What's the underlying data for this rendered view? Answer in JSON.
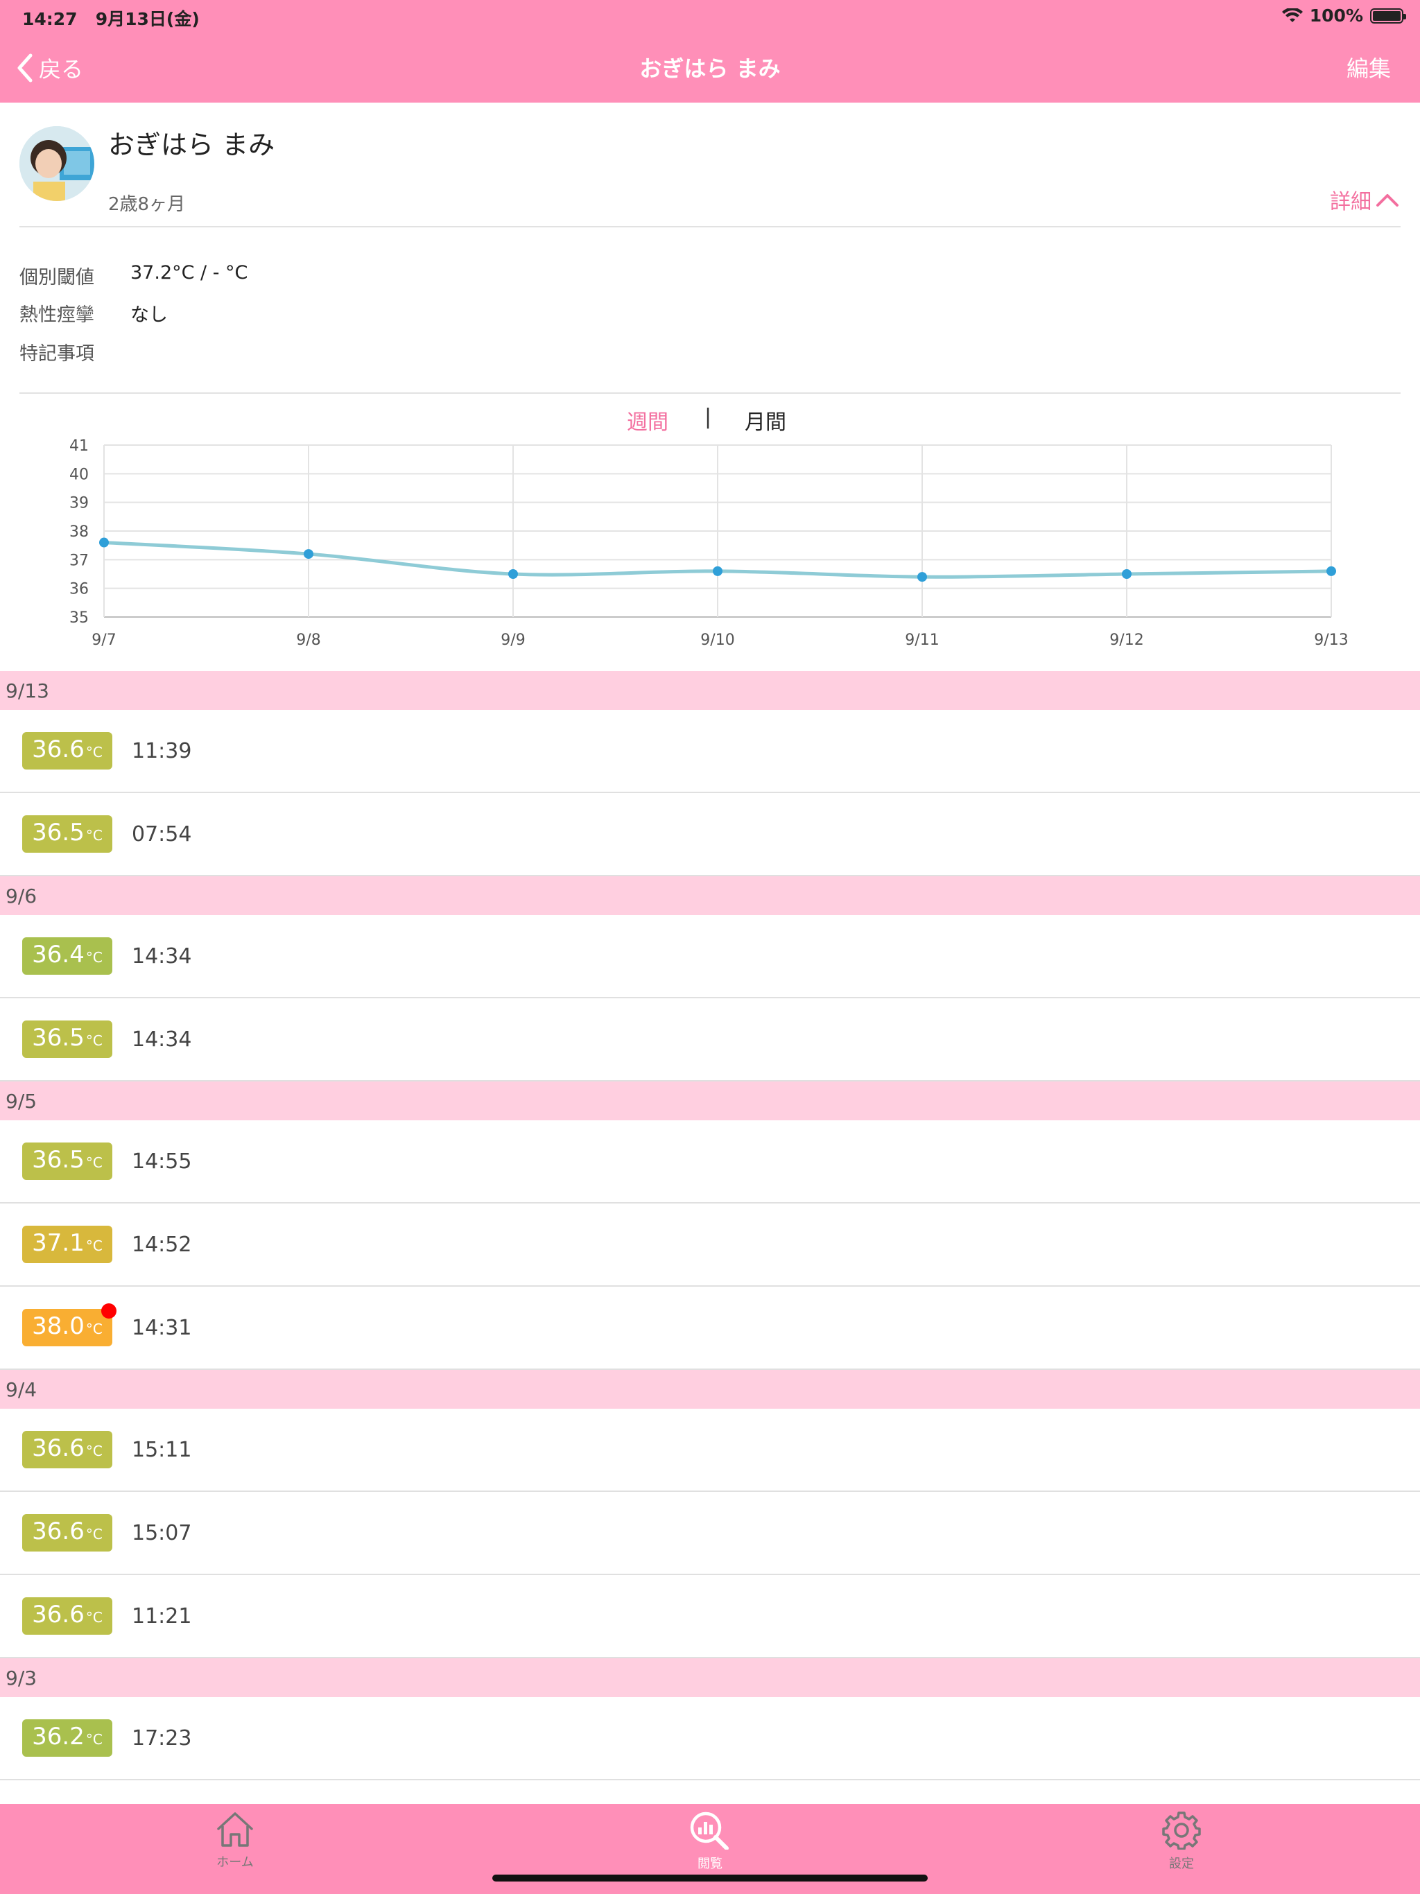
{
  "status_bar": {
    "time": "14:27",
    "date": "9月13日(金)",
    "battery": "100%"
  },
  "nav": {
    "back_label": "戻る",
    "title": "おぎはら まみ",
    "edit_label": "編集"
  },
  "profile": {
    "name": "おぎはら まみ",
    "age": "2歳8ヶ月",
    "detail_label": "詳細"
  },
  "info": [
    {
      "label": "個別閾値",
      "value": "37.2°C / - °C"
    },
    {
      "label": "熱性痙攣",
      "value": "なし"
    },
    {
      "label": "特記事項",
      "value": ""
    }
  ],
  "period_tabs": {
    "week": "週間",
    "separator": "|",
    "month": "月間",
    "selected": "week"
  },
  "chart_data": {
    "type": "line",
    "x": [
      "9/7",
      "9/8",
      "9/9",
      "9/10",
      "9/11",
      "9/12",
      "9/13"
    ],
    "values": [
      37.6,
      37.2,
      36.5,
      36.6,
      36.4,
      36.5,
      36.6
    ],
    "ylim": [
      35,
      41
    ],
    "yticks": [
      35,
      36,
      37,
      38,
      39,
      40,
      41
    ],
    "grid": true,
    "line_color": "#8ecbd6",
    "point_color": "#2f9fd8"
  },
  "unit": "°C",
  "sections": [
    {
      "date": "9/13",
      "records": [
        {
          "temp": "36.6",
          "time": "11:39",
          "color": "#bcc04a",
          "alert": false
        },
        {
          "temp": "36.5",
          "time": "07:54",
          "color": "#bcc04a",
          "alert": false
        }
      ]
    },
    {
      "date": "9/6",
      "records": [
        {
          "temp": "36.4",
          "time": "14:34",
          "color": "#a9c04e",
          "alert": false
        },
        {
          "temp": "36.5",
          "time": "14:34",
          "color": "#bcc04a",
          "alert": false
        }
      ]
    },
    {
      "date": "9/5",
      "records": [
        {
          "temp": "36.5",
          "time": "14:55",
          "color": "#bcc04a",
          "alert": false
        },
        {
          "temp": "37.1",
          "time": "14:52",
          "color": "#d8b83c",
          "alert": false
        },
        {
          "temp": "38.0",
          "time": "14:31",
          "color": "#f9ae32",
          "alert": true
        }
      ]
    },
    {
      "date": "9/4",
      "records": [
        {
          "temp": "36.6",
          "time": "15:11",
          "color": "#bcc04a",
          "alert": false
        },
        {
          "temp": "36.6",
          "time": "15:07",
          "color": "#bcc04a",
          "alert": false
        },
        {
          "temp": "36.6",
          "time": "11:21",
          "color": "#bcc04a",
          "alert": false
        }
      ]
    },
    {
      "date": "9/3",
      "records": [
        {
          "temp": "36.2",
          "time": "17:23",
          "color": "#a9c04e",
          "alert": false
        }
      ]
    }
  ],
  "tabbar": [
    {
      "label": "ホーム",
      "icon": "home-icon",
      "active": false
    },
    {
      "label": "閲覧",
      "icon": "analytics-search-icon",
      "active": true
    },
    {
      "label": "設定",
      "icon": "gear-icon",
      "active": false
    }
  ]
}
